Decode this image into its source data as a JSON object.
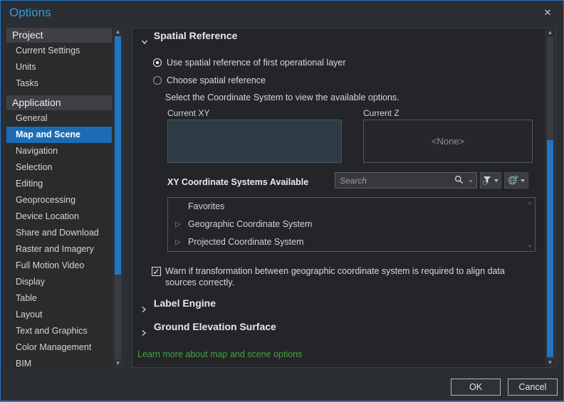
{
  "window": {
    "title": "Options",
    "close": "✕"
  },
  "sidebar": {
    "sections": [
      {
        "header": "Project",
        "items": [
          {
            "label": "Current Settings"
          },
          {
            "label": "Units"
          },
          {
            "label": "Tasks"
          }
        ]
      },
      {
        "header": "Application",
        "items": [
          {
            "label": "General"
          },
          {
            "label": "Map and Scene",
            "selected": true
          },
          {
            "label": "Navigation"
          },
          {
            "label": "Selection"
          },
          {
            "label": "Editing"
          },
          {
            "label": "Geoprocessing"
          },
          {
            "label": "Device Location"
          },
          {
            "label": "Share and Download"
          },
          {
            "label": "Raster and Imagery"
          },
          {
            "label": "Full Motion Video"
          },
          {
            "label": "Display"
          },
          {
            "label": "Table"
          },
          {
            "label": "Layout"
          },
          {
            "label": "Text and Graphics"
          },
          {
            "label": "Color Management"
          },
          {
            "label": "BIM"
          }
        ]
      }
    ]
  },
  "main": {
    "spatial_reference": {
      "title": "Spatial Reference",
      "radio_first_layer": "Use spatial reference of first operational layer",
      "radio_choose": "Choose spatial reference",
      "note": "Select the Coordinate System to view the available options.",
      "current_xy_label": "Current XY",
      "current_z_label": "Current Z",
      "current_z_value": "<None>",
      "xy_available_label": "XY Coordinate Systems Available",
      "search_placeholder": "Search",
      "coordinate_systems": [
        {
          "label": "Favorites",
          "expandable": false
        },
        {
          "label": "Geographic Coordinate System",
          "expandable": true
        },
        {
          "label": "Projected Coordinate System",
          "expandable": true
        }
      ],
      "warn_checkbox_label": "Warn if transformation between geographic coordinate system is required to align data sources correctly.",
      "warn_checked": "✓"
    },
    "collapsed_sections": [
      {
        "title": "Label Engine"
      },
      {
        "title": "Ground Elevation Surface"
      }
    ],
    "learn_more_link": "Learn more about map and scene options"
  },
  "footer": {
    "ok": "OK",
    "cancel": "Cancel"
  },
  "colors": {
    "accent_selection": "#1c6cb4",
    "title_blue": "#3498da",
    "scroll_thumb_blue": "#1f76c4",
    "link_green": "#46a046",
    "current_xy_fill": "#2d3b45"
  }
}
